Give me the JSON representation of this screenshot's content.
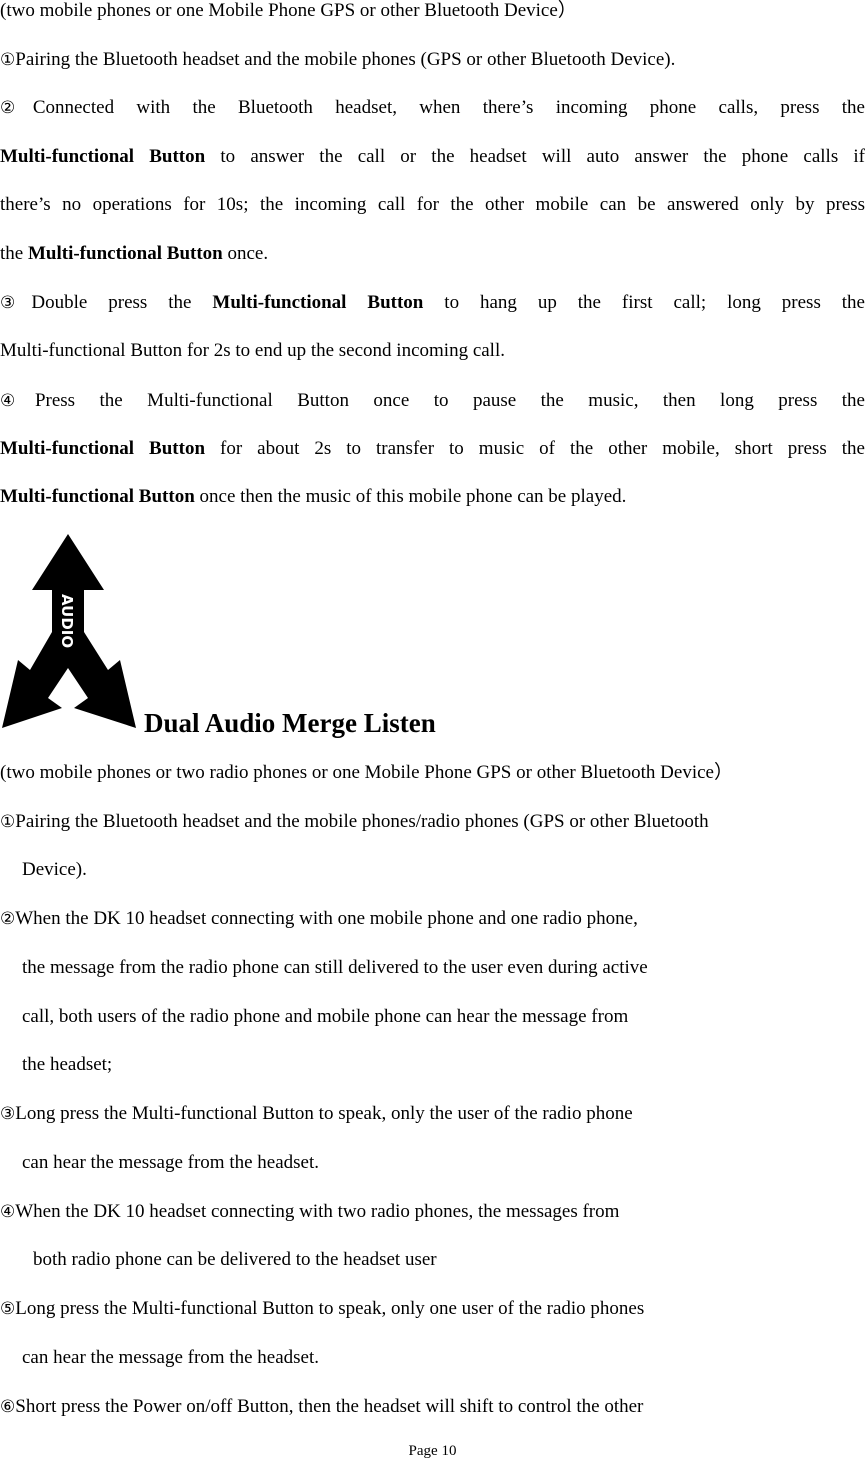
{
  "section1": {
    "intro": "(two mobile phones or one Mobile Phone GPS or other Bluetooth Device）",
    "items": [
      {
        "marker": "①",
        "text": "Pairing the Bluetooth headset and the mobile phones (GPS or other Bluetooth Device)."
      },
      {
        "marker": "②",
        "line1": "Connected with the Bluetooth headset, when there’s incoming phone calls, press the",
        "line2_bold": "Multi-functional Button",
        "line2_rest": " to answer the call or the headset will auto answer the phone calls if",
        "line3": "there’s no operations for 10s; the incoming call for the other mobile can be answered only by press",
        "line4_pre": "the ",
        "line4_bold": "Multi-functional Button",
        "line4_rest": " once."
      },
      {
        "marker": "③",
        "line1_pre": "Double press the ",
        "line1_bold": "Multi-functional Button",
        "line1_rest": " to hang up the first call; long press the",
        "line2": "Multi-functional Button for 2s to end up the second incoming call."
      },
      {
        "marker": "④",
        "line1": "Press the Multi-functional Button once to pause the music, then long press the",
        "line2_bold": "Multi-functional Button",
        "line2_rest": " for about 2s to transfer to music of the other mobile, short press the",
        "line3_bold": "Multi-functional Button",
        "line3_rest": " once then the music of this mobile phone can be played."
      }
    ]
  },
  "section2": {
    "icon": "audio-merge-arrow-icon",
    "icon_label": "AUDIO",
    "heading": "Dual Audio Merge Listen",
    "intro": "(two mobile phones or two radio phones or one Mobile Phone GPS or other Bluetooth Device）",
    "items": [
      {
        "marker": "①",
        "lines": [
          "Pairing the Bluetooth headset and the mobile phones/radio phones (GPS or other Bluetooth",
          "Device)."
        ]
      },
      {
        "marker": "②",
        "lines": [
          "When the DK 10 headset connecting with one mobile phone and one radio phone,",
          "the message from the radio phone can still delivered to the user even during active",
          "call, both users of the radio phone and mobile phone can hear the message from",
          "the headset;"
        ]
      },
      {
        "marker": "③",
        "lines": [
          "Long press the Multi-functional Button to speak, only the user of the radio phone",
          "can hear the message from the headset."
        ]
      },
      {
        "marker": "④",
        "lines": [
          "When the DK 10 headset connecting with two radio phones, the messages from",
          "both radio phone can be delivered to the headset user"
        ]
      },
      {
        "marker": "⑤",
        "lines": [
          "Long press the Multi-functional Button to speak, only one user of the radio phones",
          "can hear the message from the headset."
        ]
      },
      {
        "marker": "⑥",
        "lines": [
          "Short press the Power on/off Button, then the headset will shift to control the other"
        ]
      }
    ]
  },
  "footer": {
    "page_label": "Page 10"
  }
}
